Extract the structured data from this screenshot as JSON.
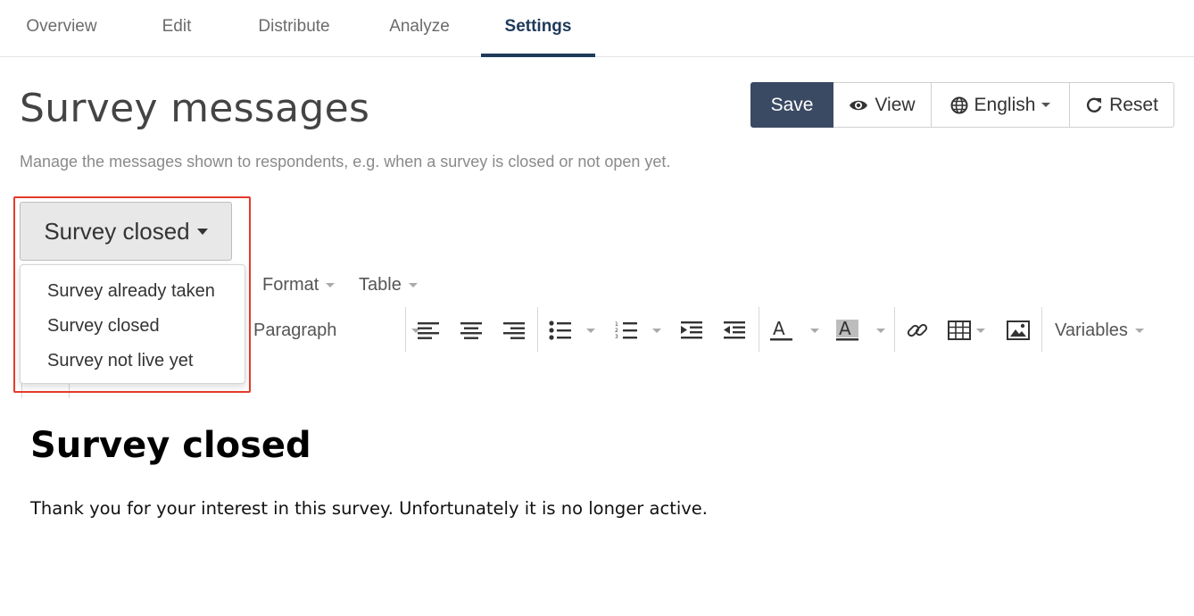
{
  "tabs": [
    {
      "label": "Overview",
      "active": false
    },
    {
      "label": "Edit",
      "active": false
    },
    {
      "label": "Distribute",
      "active": false
    },
    {
      "label": "Analyze",
      "active": false
    },
    {
      "label": "Settings",
      "active": true
    }
  ],
  "header": {
    "title": "Survey messages",
    "subtitle": "Manage the messages shown to respondents, e.g. when a survey is closed or not open yet.",
    "save_label": "Save",
    "view_label": "View",
    "language_label": "English",
    "reset_label": "Reset"
  },
  "message_select": {
    "selected": "Survey closed",
    "options": [
      "Survey already taken",
      "Survey closed",
      "Survey not live yet"
    ]
  },
  "toolbar": {
    "format_label": "Format",
    "table_label": "Table",
    "block_format": "Paragraph",
    "variables_label": "Variables"
  },
  "editor": {
    "heading": "Survey closed",
    "body": "Thank you for your interest in this survey. Unfortunately it is no longer active."
  },
  "colors": {
    "accent": "#1f3a5a",
    "save_button": "#3b4a63",
    "highlight": "#e53a2c"
  }
}
